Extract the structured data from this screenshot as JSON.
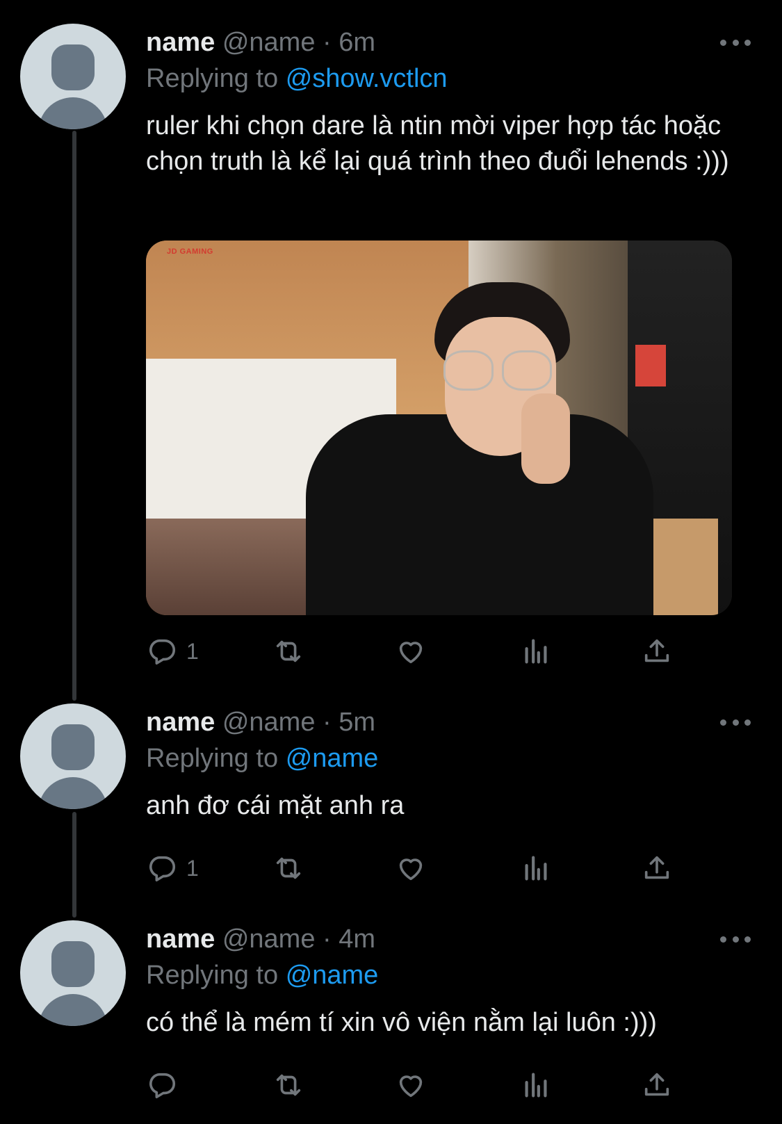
{
  "tweets": [
    {
      "name": "name",
      "handle": "@name",
      "separator": "·",
      "time": "6m",
      "replying_prefix": "Replying to",
      "replying_to": "@show.vctlcn",
      "text": "ruler khi chọn dare là ntin mời viper hợp tác hoặc chọn truth là kể lại quá trình theo đuổi lehends :)))",
      "media_watermark": "JD GAMING",
      "reply_count": "1"
    },
    {
      "name": "name",
      "handle": "@name",
      "separator": "·",
      "time": "5m",
      "replying_prefix": "Replying to",
      "replying_to": "@name",
      "text": "anh đơ cái mặt anh ra",
      "reply_count": "1"
    },
    {
      "name": "name",
      "handle": "@name",
      "separator": "·",
      "time": "4m",
      "replying_prefix": "Replying to",
      "replying_to": "@name",
      "text": "có thể là mém tí xin vô viện nằm lại luôn :)))",
      "reply_count": ""
    }
  ],
  "icons": [
    "reply-icon",
    "retweet-icon",
    "like-icon",
    "analytics-icon",
    "share-icon",
    "more-icon"
  ],
  "colors": {
    "background": "#000000",
    "text": "#e7e9ea",
    "secondary": "#71767b",
    "link": "#1d9bf0"
  }
}
